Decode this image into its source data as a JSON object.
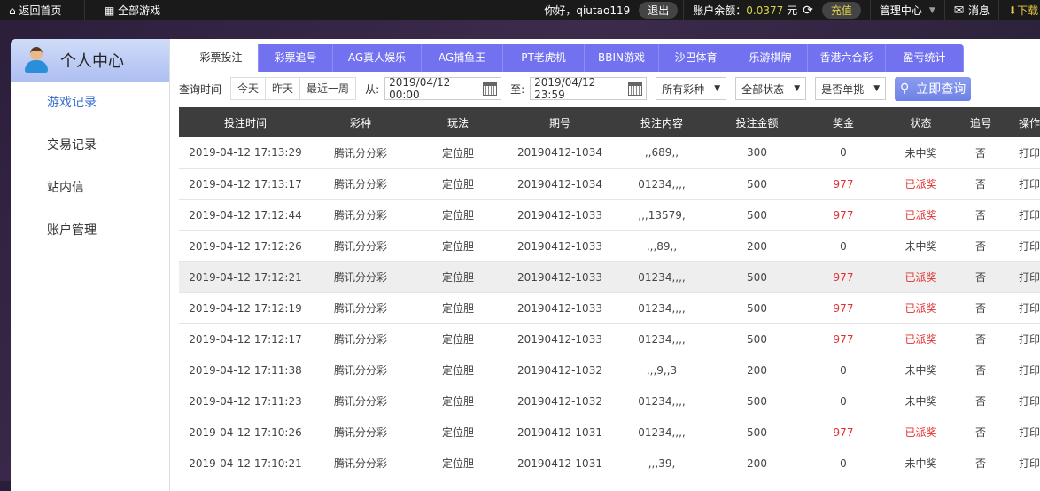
{
  "topbar": {
    "home": "返回首页",
    "all_games": "全部游戏",
    "greeting": "你好，qiutao119",
    "logout": "退出",
    "balance_label": "账户余额：",
    "balance": "0.0377",
    "currency": "元",
    "recharge": "充值",
    "admin": "管理中心",
    "messages": "消息",
    "download": "下载"
  },
  "sidebar": {
    "title": "个人中心",
    "items": [
      "游戏记录",
      "交易记录",
      "站内信",
      "账户管理"
    ]
  },
  "tabs": [
    "彩票投注",
    "彩票追号",
    "AG真人娱乐",
    "AG捕鱼王",
    "PT老虎机",
    "BBIN游戏",
    "沙巴体育",
    "乐游棋牌",
    "香港六合彩",
    "盈亏统计"
  ],
  "filters": {
    "label": "查询时间",
    "today": "今天",
    "yesterday": "昨天",
    "week": "最近一周",
    "from": "从:",
    "from_value": "2019/04/12 00:00",
    "to": "至:",
    "to_value": "2019/04/12 23:59",
    "lottery": "所有彩种",
    "status": "全部状态",
    "single": "是否单挑",
    "query": "立即查询"
  },
  "table": {
    "headers": [
      "投注时间",
      "彩种",
      "玩法",
      "期号",
      "投注内容",
      "投注金额",
      "奖金",
      "状态",
      "追号",
      "操作"
    ],
    "rows": [
      [
        "2019-04-12 17:13:29",
        "腾讯分分彩",
        "定位胆",
        "20190412-1034",
        ",,689,,",
        "300",
        "0",
        "未中奖",
        "否",
        "打印"
      ],
      [
        "2019-04-12 17:13:17",
        "腾讯分分彩",
        "定位胆",
        "20190412-1034",
        "01234,,,,",
        "500",
        "977",
        "已派奖",
        "否",
        "打印"
      ],
      [
        "2019-04-12 17:12:44",
        "腾讯分分彩",
        "定位胆",
        "20190412-1033",
        ",,,13579,",
        "500",
        "977",
        "已派奖",
        "否",
        "打印"
      ],
      [
        "2019-04-12 17:12:26",
        "腾讯分分彩",
        "定位胆",
        "20190412-1033",
        ",,,89,,",
        "200",
        "0",
        "未中奖",
        "否",
        "打印"
      ],
      [
        "2019-04-12 17:12:21",
        "腾讯分分彩",
        "定位胆",
        "20190412-1033",
        "01234,,,,",
        "500",
        "977",
        "已派奖",
        "否",
        "打印"
      ],
      [
        "2019-04-12 17:12:19",
        "腾讯分分彩",
        "定位胆",
        "20190412-1033",
        "01234,,,,",
        "500",
        "977",
        "已派奖",
        "否",
        "打印"
      ],
      [
        "2019-04-12 17:12:17",
        "腾讯分分彩",
        "定位胆",
        "20190412-1033",
        "01234,,,,",
        "500",
        "977",
        "已派奖",
        "否",
        "打印"
      ],
      [
        "2019-04-12 17:11:38",
        "腾讯分分彩",
        "定位胆",
        "20190412-1032",
        ",,,9,,3",
        "200",
        "0",
        "未中奖",
        "否",
        "打印"
      ],
      [
        "2019-04-12 17:11:23",
        "腾讯分分彩",
        "定位胆",
        "20190412-1032",
        "01234,,,,",
        "500",
        "0",
        "未中奖",
        "否",
        "打印"
      ],
      [
        "2019-04-12 17:10:26",
        "腾讯分分彩",
        "定位胆",
        "20190412-1031",
        "01234,,,,",
        "500",
        "977",
        "已派奖",
        "否",
        "打印"
      ],
      [
        "2019-04-12 17:10:21",
        "腾讯分分彩",
        "定位胆",
        "20190412-1031",
        ",,,39,",
        "200",
        "0",
        "未中奖",
        "否",
        "打印"
      ]
    ]
  }
}
